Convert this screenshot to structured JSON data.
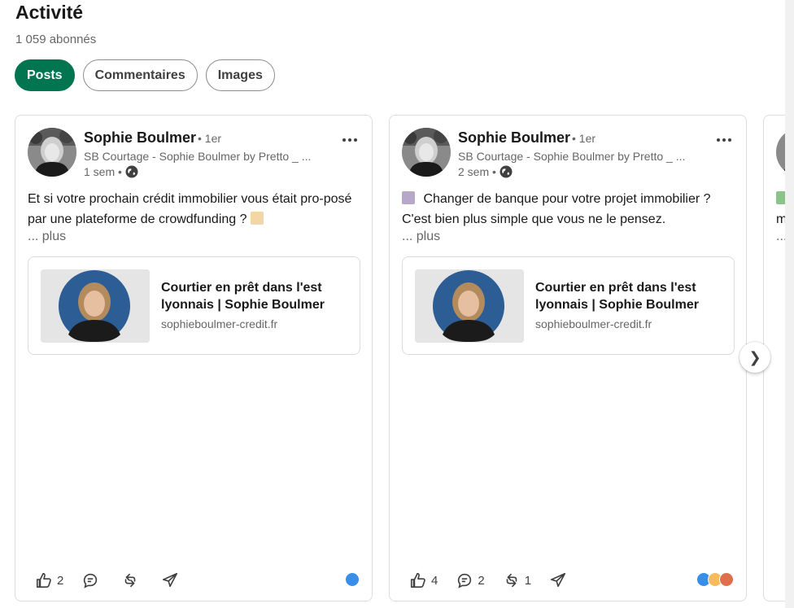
{
  "section": {
    "title": "Activité",
    "followers": "1 059 abonnés"
  },
  "filters": [
    {
      "label": "Posts",
      "active": true
    },
    {
      "label": "Commentaires",
      "active": false
    },
    {
      "label": "Images",
      "active": false
    }
  ],
  "posts": [
    {
      "author": "Sophie Boulmer",
      "degree": "• 1er",
      "headline": "SB Courtage - Sophie Boulmer by Pretto _ ...",
      "time": "1 sem •",
      "text": "Et si votre prochain crédit immobilier vous était pro-posé par une plateforme de crowdfunding ?",
      "see_more": "... plus",
      "link_title": "Courtier en prêt dans l'est lyonnais | Sophie Boulmer",
      "link_domain": "sophieboulmer-credit.fr",
      "likes": "2",
      "comments": "",
      "reposts": ""
    },
    {
      "author": "Sophie Boulmer",
      "degree": "• 1er",
      "headline": "SB Courtage - Sophie Boulmer by Pretto _ ...",
      "time": "2 sem •",
      "text": "Changer de banque pour votre projet immobilier ? C'est bien plus simple que vous ne le pensez.",
      "see_more": "... plus",
      "link_title": "Courtier en prêt dans l'est lyonnais | Sophie Boulmer",
      "link_domain": "sophieboulmer-credit.fr",
      "likes": "4",
      "comments": "2",
      "reposts": "1"
    },
    {
      "text_fragment": "m",
      "see_more": "..."
    }
  ],
  "next_icon": "chevron-right-icon",
  "colors": {
    "accent": "#01754f",
    "like_blue": "#378fe9",
    "text_muted": "#666666"
  }
}
